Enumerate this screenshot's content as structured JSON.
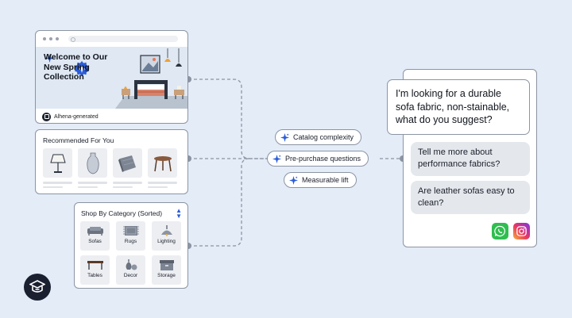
{
  "hero": {
    "title_lines": [
      "Welcome to Our",
      "New Spring",
      "Collection"
    ],
    "footer_label": "Alhena-generated"
  },
  "recommended": {
    "title": "Recommended For You",
    "items": [
      {
        "icon": "lamp-icon"
      },
      {
        "icon": "vase-icon"
      },
      {
        "icon": "blanket-icon"
      },
      {
        "icon": "stool-icon"
      }
    ]
  },
  "category": {
    "title": "Shop By Category (Sorted)",
    "items": [
      {
        "label": "Sofas",
        "icon": "sofa-icon"
      },
      {
        "label": "Rugs",
        "icon": "rug-icon"
      },
      {
        "label": "Lighting",
        "icon": "pendant-lamp-icon"
      },
      {
        "label": "Tables",
        "icon": "table-icon"
      },
      {
        "label": "Decor",
        "icon": "decor-icon"
      },
      {
        "label": "Storage",
        "icon": "storage-box-icon"
      }
    ]
  },
  "pills": [
    {
      "label": "Catalog complexity"
    },
    {
      "label": "Pre-purchase questions"
    },
    {
      "label": "Measurable lift"
    }
  ],
  "chat": {
    "user_message": "I'm looking for a durable sofa fabric, non-stainable, what do you suggest?",
    "bot_messages": [
      "Tell me more about performance fabrics?",
      "Are leather sofas easy to clean?"
    ]
  },
  "colors": {
    "background": "#e3ecf7",
    "accent": "#2a5bd7",
    "whatsapp": "#2fbe4f"
  }
}
